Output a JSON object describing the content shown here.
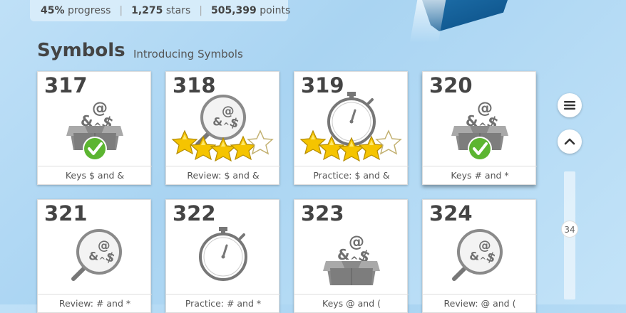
{
  "stats": {
    "progress": "45%",
    "progress_label": "progress",
    "stars": "1,275",
    "stars_label": "stars",
    "points": "505,399",
    "points_label": "points"
  },
  "section": {
    "title": "Symbols",
    "subtitle": "Introducing Symbols"
  },
  "lessons": [
    {
      "number": "317",
      "label": "Keys $ and &",
      "icon": "symbols-box-icon",
      "status": "completed-check"
    },
    {
      "number": "318",
      "label": "Review: $ and &",
      "icon": "magnifier-symbols-icon",
      "stars_earned": 4,
      "stars_total": 5
    },
    {
      "number": "319",
      "label": "Practice: $ and &",
      "icon": "stopwatch-icon",
      "stars_earned": 4,
      "stars_total": 5
    },
    {
      "number": "320",
      "label": "Keys # and *",
      "icon": "symbols-box-icon",
      "status": "completed-check"
    },
    {
      "number": "321",
      "label": "Review: # and *",
      "icon": "magnifier-symbols-icon"
    },
    {
      "number": "322",
      "label": "Practice: # and *",
      "icon": "stopwatch-icon"
    },
    {
      "number": "323",
      "label": "Keys @ and (",
      "icon": "symbols-box-icon"
    },
    {
      "number": "324",
      "label": "Review: @ and (",
      "icon": "magnifier-symbols-icon"
    }
  ],
  "scroll": {
    "position_label": "34"
  },
  "colors": {
    "accent_green": "#5cb531",
    "star_gold": "#f5c400",
    "icon_gray": "#777777"
  }
}
